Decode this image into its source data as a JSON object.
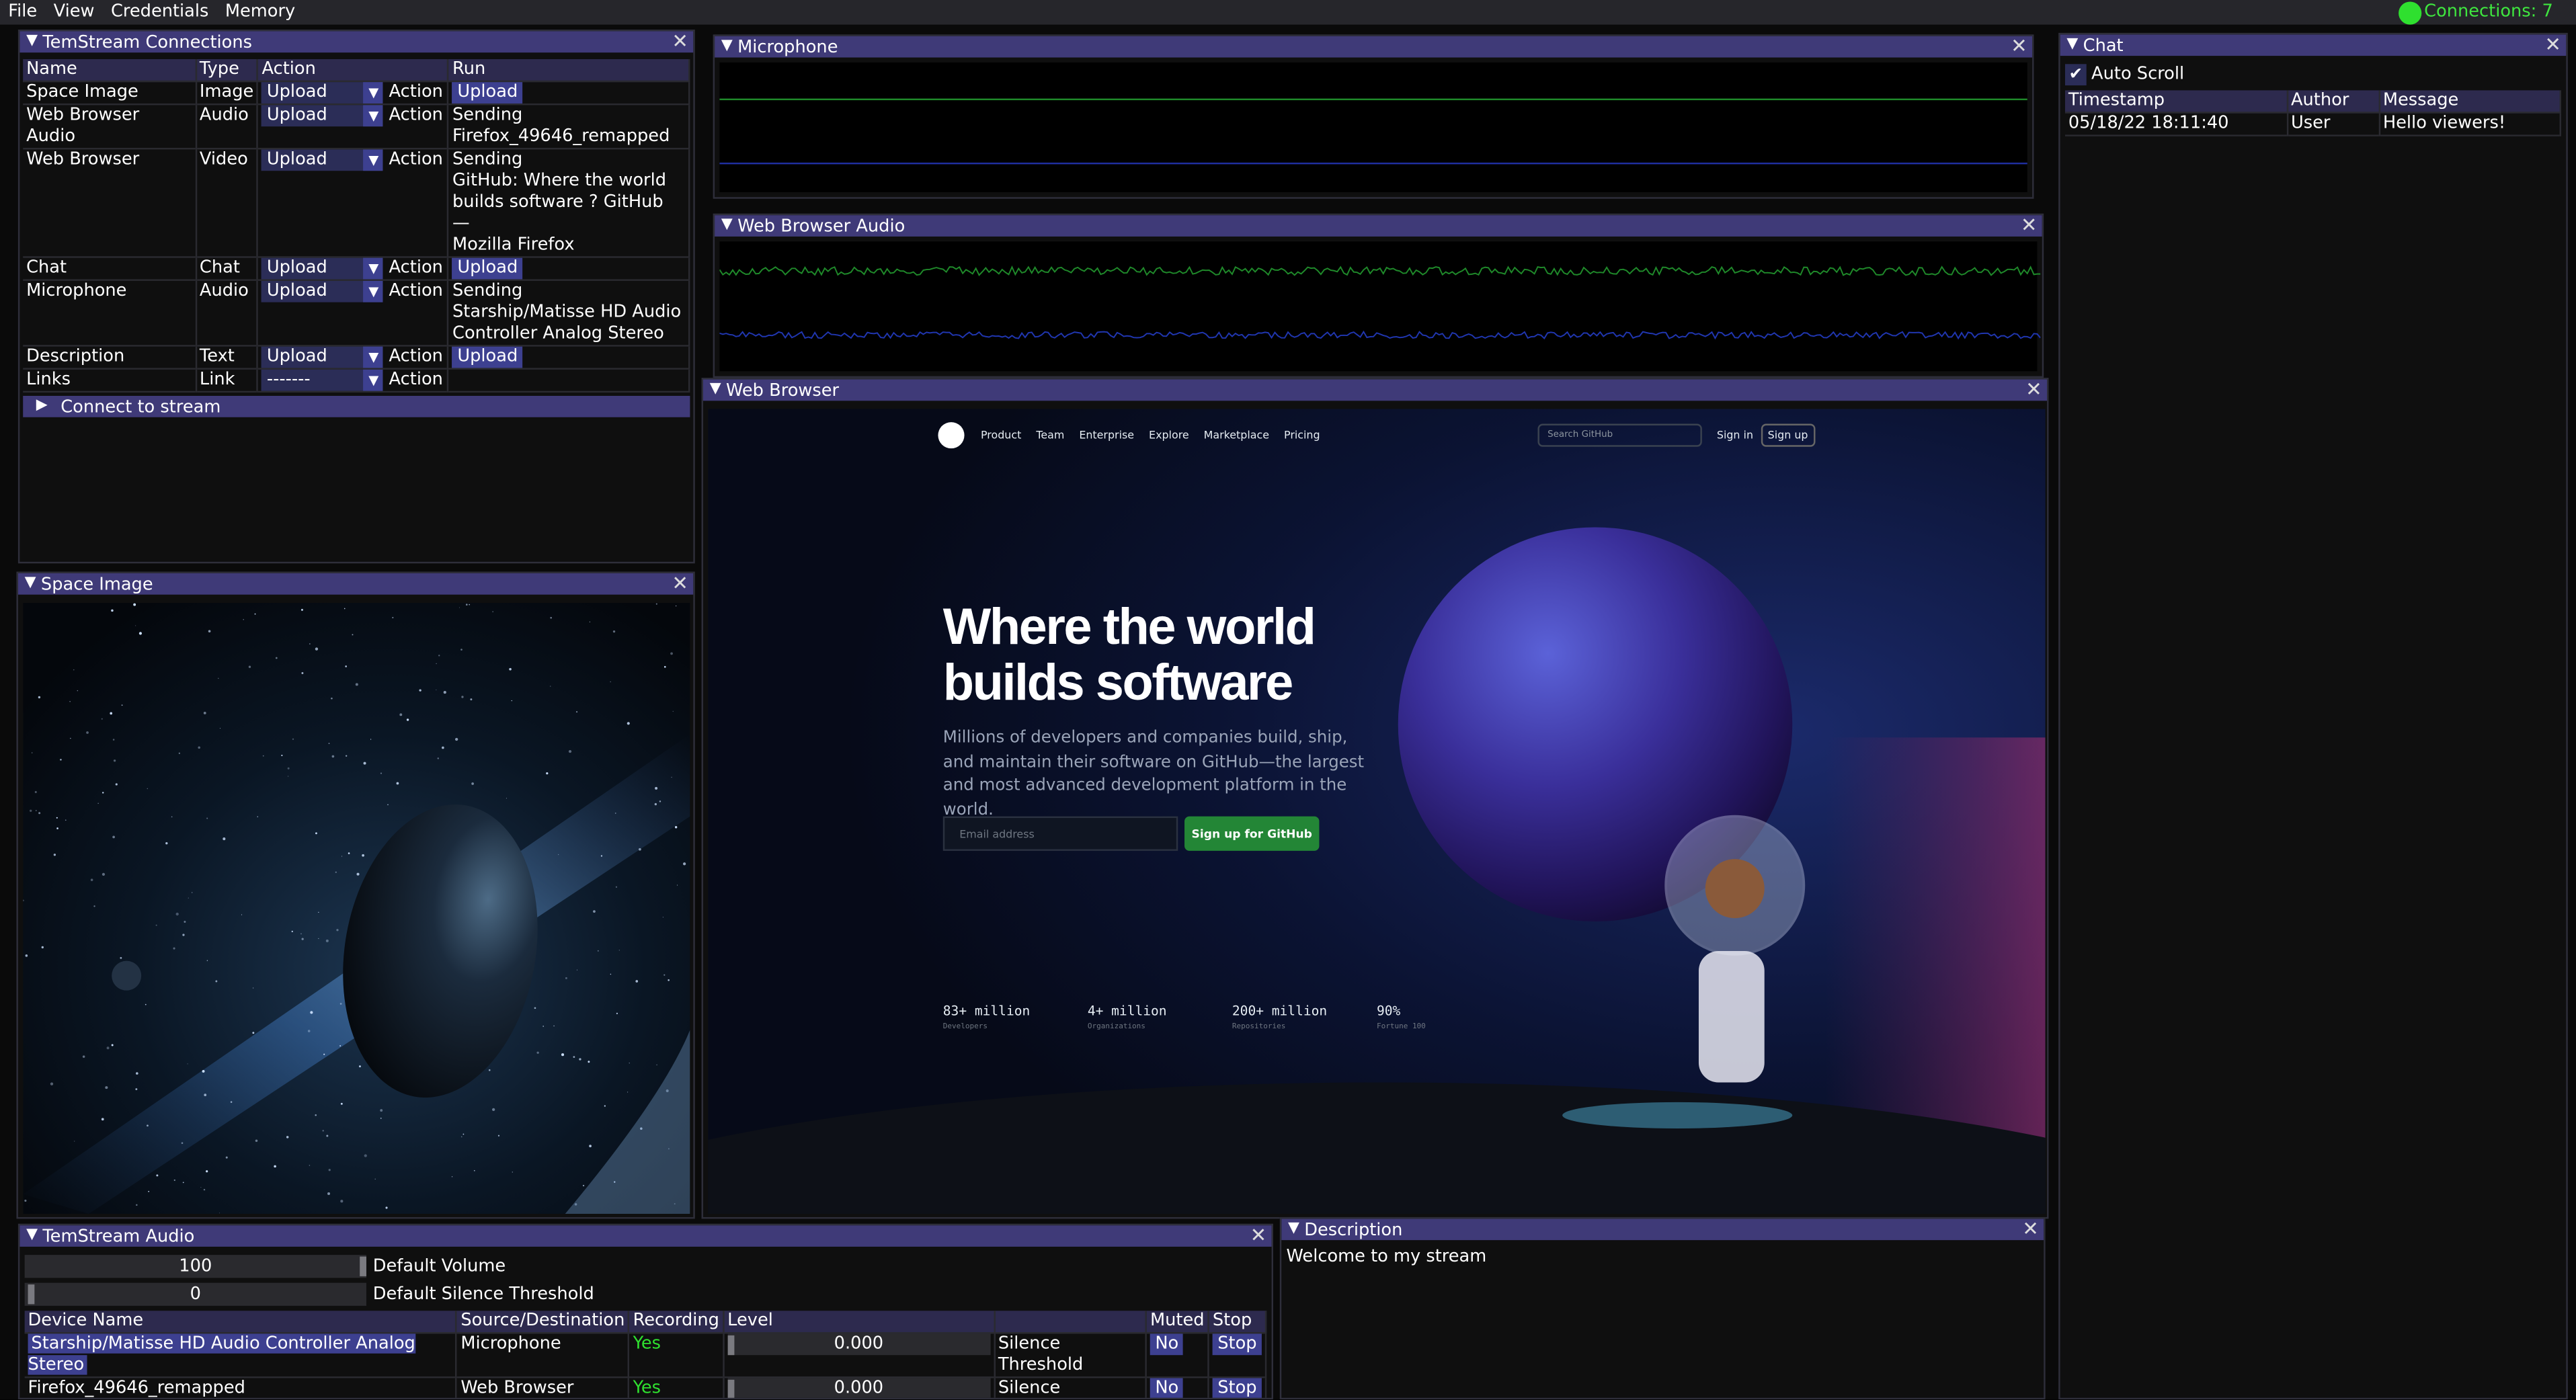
{
  "menubar": {
    "items": [
      "File",
      "View",
      "Credentials",
      "Memory"
    ],
    "connections": "Connections: 7"
  },
  "connections_window": {
    "title": "TemStream Connections",
    "columns": [
      "Name",
      "Type",
      "Action",
      "Run"
    ],
    "rows": [
      {
        "name": "Space Image",
        "type": "Image",
        "combo": "Upload",
        "action": "Action",
        "run": "Upload",
        "run_is_button": true
      },
      {
        "name": "Web Browser Audio",
        "type": "Audio",
        "combo": "Upload",
        "action": "Action",
        "run": "Sending\nFirefox_49646_remapped",
        "run_is_button": false
      },
      {
        "name": "Web Browser",
        "type": "Video",
        "combo": "Upload",
        "action": "Action",
        "run": "Sending\nGitHub: Where the world\nbuilds software ? GitHub —\nMozilla Firefox",
        "run_is_button": false
      },
      {
        "name": "Chat",
        "type": "Chat",
        "combo": "Upload",
        "action": "Action",
        "run": "Upload",
        "run_is_button": true
      },
      {
        "name": "Microphone",
        "type": "Audio",
        "combo": "Upload",
        "action": "Action",
        "run": "Sending\nStarship/Matisse HD Audio\nController Analog Stereo",
        "run_is_button": false
      },
      {
        "name": "Description",
        "type": "Text",
        "combo": "Upload",
        "action": "Action",
        "run": "Upload",
        "run_is_button": true
      },
      {
        "name": "Links",
        "type": "Link",
        "combo": "-------",
        "action": "Action",
        "run": "",
        "run_is_button": false
      }
    ],
    "connect_label": "Connect to stream"
  },
  "microphone_window": {
    "title": "Microphone"
  },
  "web_audio_window": {
    "title": "Web Browser Audio"
  },
  "space_image_window": {
    "title": "Space Image"
  },
  "web_browser_window": {
    "title": "Web Browser",
    "nav": [
      "Product",
      "Team",
      "Enterprise",
      "Explore",
      "Marketplace",
      "Pricing"
    ],
    "search_placeholder": "Search GitHub",
    "sign_in": "Sign in",
    "sign_up": "Sign up",
    "headline1": "Where the world",
    "headline2": "builds software",
    "subtitle": "Millions of developers and companies build, ship, and maintain their software on GitHub—the largest and most advanced development platform in the world.",
    "email_placeholder": "Email address",
    "cta": "Sign up for GitHub",
    "stats": [
      {
        "value": "83+ million",
        "label": "Developers"
      },
      {
        "value": "4+ million",
        "label": "Organizations"
      },
      {
        "value": "200+ million",
        "label": "Repositories"
      },
      {
        "value": "90%",
        "label": "Fortune 100"
      }
    ]
  },
  "chat_window": {
    "title": "Chat",
    "auto_scroll": "Auto Scroll",
    "columns": [
      "Timestamp",
      "Author",
      "Message"
    ],
    "rows": [
      {
        "timestamp": "05/18/22 18:11:40",
        "author": "User",
        "message": "Hello viewers!"
      }
    ]
  },
  "audio_window": {
    "title": "TemStream Audio",
    "default_volume": "100",
    "default_volume_label": "Default Volume",
    "default_silence": "0",
    "default_silence_label": "Default Silence Threshold",
    "columns": [
      "Device Name",
      "Source/Destination",
      "Recording",
      "Level",
      "",
      "Muted",
      "Stop"
    ],
    "devices": [
      {
        "name": "Starship/Matisse HD Audio Controller Analog Stereo",
        "source": "Microphone",
        "recording": "Yes",
        "level": "0.000",
        "threshold": "Silence Threshold",
        "muted": "No",
        "stop": "Stop"
      },
      {
        "name": "Firefox_49646_remapped",
        "source": "Web Browser Audio",
        "recording": "Yes",
        "level": "0.000",
        "threshold": "Silence Threshold",
        "muted": "No",
        "stop": "Stop"
      }
    ]
  },
  "description_window": {
    "title": "Description",
    "text": "Welcome to my stream"
  },
  "colors": {
    "title_bar": "#3f3a78",
    "button": "#3d4090",
    "accent_green": "#2fe02f",
    "cta_green": "#238636"
  }
}
